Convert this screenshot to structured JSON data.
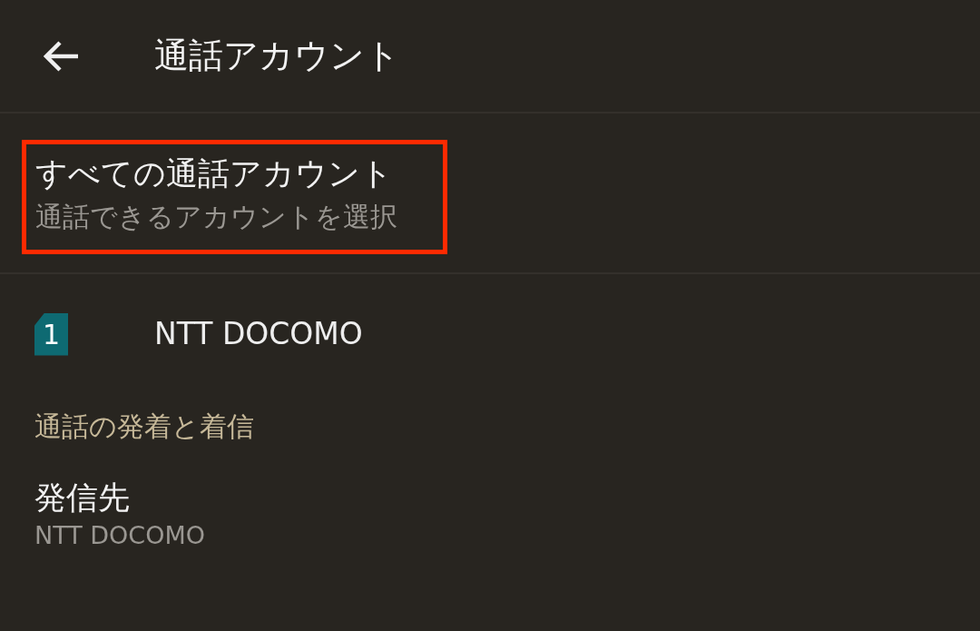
{
  "header": {
    "title": "通話アカウント"
  },
  "all_accounts": {
    "title": "すべての通話アカウント",
    "subtitle": "通話できるアカウントを選択",
    "highlighted": true
  },
  "accounts": [
    {
      "sim_number": "1",
      "name": "NTT DOCOMO"
    }
  ],
  "section": {
    "title": "通話の発着と着信"
  },
  "settings": [
    {
      "title": "発信先",
      "value": "NTT DOCOMO"
    }
  ]
}
